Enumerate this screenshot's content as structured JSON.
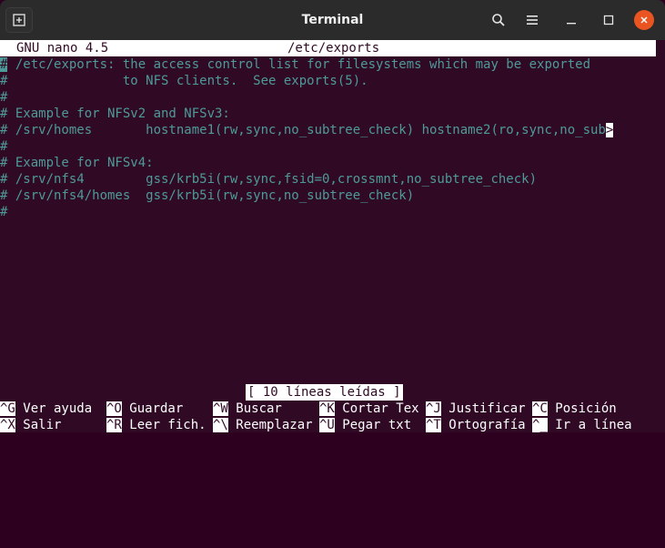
{
  "window": {
    "title": "Terminal",
    "close_color": "#e95420",
    "icons": [
      "new-tab-icon",
      "search-icon",
      "hamburger-menu-icon",
      "minimize-icon",
      "maximize-icon",
      "close-icon"
    ]
  },
  "nano": {
    "version": "GNU nano 4.5",
    "filename": "/etc/exports",
    "status": "[ 10 líneas leídas ]",
    "lines": [
      {
        "cursor": "#",
        "text": " /etc/exports: the access control list for filesystems which may be exported"
      },
      {
        "text": "#               to NFS clients.  See exports(5)."
      },
      {
        "text": "#"
      },
      {
        "text": "# Example for NFSv2 and NFSv3:"
      },
      {
        "text": "# /srv/homes       hostname1(rw,sync,no_subtree_check) hostname2(ro,sync,no_sub",
        "overflow": ">"
      },
      {
        "text": "#"
      },
      {
        "text": "# Example for NFSv4:"
      },
      {
        "text": "# /srv/nfs4        gss/krb5i(rw,sync,fsid=0,crossmnt,no_subtree_check)"
      },
      {
        "text": "# /srv/nfs4/homes  gss/krb5i(rw,sync,no_subtree_check)"
      },
      {
        "text": "#"
      }
    ],
    "help_row1": [
      {
        "key": "^G",
        "label": " Ver ayuda"
      },
      {
        "key": "^O",
        "label": " Guardar"
      },
      {
        "key": "^W",
        "label": " Buscar"
      },
      {
        "key": "^K",
        "label": " Cortar Tex"
      },
      {
        "key": "^J",
        "label": " Justificar"
      },
      {
        "key": "^C",
        "label": " Posición"
      }
    ],
    "help_row2": [
      {
        "key": "^X",
        "label": " Salir"
      },
      {
        "key": "^R",
        "label": " Leer fich."
      },
      {
        "key": "^\\",
        "label": " Reemplazar"
      },
      {
        "key": "^U",
        "label": " Pegar txt"
      },
      {
        "key": "^T",
        "label": " Ortografía"
      },
      {
        "key": "^_",
        "label": " Ir a línea"
      }
    ],
    "colors": {
      "background": "#300a24",
      "text": "#4e9a98",
      "bar": "#ffffff"
    }
  }
}
